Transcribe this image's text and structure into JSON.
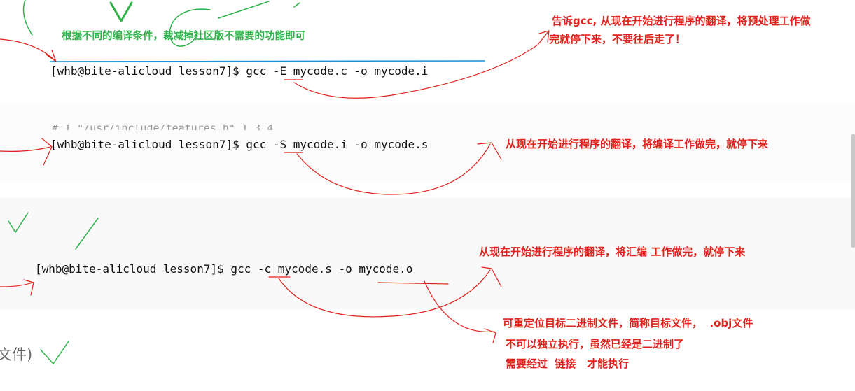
{
  "commands": [
    "[whb@bite-alicloud lesson7]$ gcc -E mycode.c -o mycode.i",
    "[whb@bite-alicloud lesson7]$ gcc -S mycode.i -o mycode.s",
    "[whb@bite-alicloud lesson7]$ gcc -c mycode.s -o mycode.o"
  ],
  "partial_line": "# 1 \"/usr/include/features.h\" 1 3 4",
  "notes": {
    "green_note": "根据不同的编译条件，裁减掉社区版不需要的功能即可",
    "preprocess_line1": "告诉gcc, 从现在开始进行程序的翻译，将预处理工作做",
    "preprocess_line2": "完就停下来，不要往后走了！",
    "compile": "从现在开始进行程序的翻译，将编译工作做完，就停下来",
    "assemble": "从现在开始进行程序的翻译，将汇编 工作做完，就停下来",
    "object_line1": "可重定位目标二进制文件，简称目标文件，  .obj文件",
    "object_line2": "不可以独立执行，虽然已经是二进制了",
    "object_line3": "需要经过  链接   才能执行"
  },
  "partial_doc_text": "文件)",
  "colors": {
    "annotation_red": "#e0221c",
    "annotation_green": "#2fb24a",
    "divider_blue": "#1f8fd6",
    "terminal_text": "#111111"
  }
}
